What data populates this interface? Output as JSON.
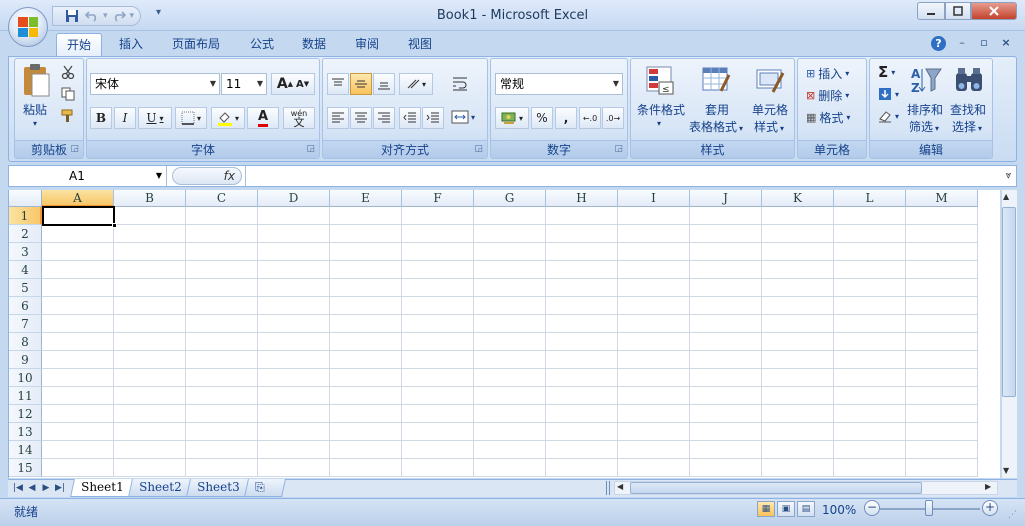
{
  "window": {
    "title": "Book1 - Microsoft Excel"
  },
  "qat": {
    "save_icon": "save-icon",
    "undo_icon": "undo-icon",
    "redo_icon": "redo-icon",
    "customize_icon": "customize-qat-icon"
  },
  "tabs": [
    {
      "label": "开始",
      "active": true
    },
    {
      "label": "插入"
    },
    {
      "label": "页面布局"
    },
    {
      "label": "公式"
    },
    {
      "label": "数据"
    },
    {
      "label": "审阅"
    },
    {
      "label": "视图"
    }
  ],
  "ribbon": {
    "clipboard": {
      "title": "剪贴板",
      "paste": "粘贴"
    },
    "font": {
      "title": "字体",
      "font_name": "宋体",
      "font_size": "11",
      "bold": "B",
      "italic": "I",
      "underline": "U",
      "grow": "A",
      "shrink": "A",
      "font_color": "A",
      "phonetic_top": "wén",
      "phonetic_bottom": "文"
    },
    "alignment": {
      "title": "对齐方式"
    },
    "number": {
      "title": "数字",
      "format": "常规",
      "percent": "%",
      "comma": ","
    },
    "styles": {
      "title": "样式",
      "cond_format": "条件格式",
      "table_format_1": "套用",
      "table_format_2": "表格格式",
      "cell_style_1": "单元格",
      "cell_style_2": "样式"
    },
    "cells": {
      "title": "单元格",
      "insert": "插入",
      "delete": "删除",
      "format": "格式"
    },
    "editing": {
      "title": "编辑",
      "sum": "Σ",
      "sort_1": "排序和",
      "sort_2": "筛选",
      "find_1": "查找和",
      "find_2": "选择"
    }
  },
  "formula_bar": {
    "name_box": "A1",
    "fx": "fx",
    "value": ""
  },
  "grid": {
    "columns": [
      "A",
      "B",
      "C",
      "D",
      "E",
      "F",
      "G",
      "H",
      "I",
      "J",
      "K",
      "L",
      "M"
    ],
    "rows": [
      "1",
      "2",
      "3",
      "4",
      "5",
      "6",
      "7",
      "8",
      "9",
      "10",
      "11",
      "12",
      "13",
      "14",
      "15"
    ],
    "selected_cell": "A1"
  },
  "sheets": [
    {
      "label": "Sheet1",
      "active": true
    },
    {
      "label": "Sheet2"
    },
    {
      "label": "Sheet3"
    }
  ],
  "status": {
    "text": "就绪",
    "zoom": "100%",
    "zoom_out": "−",
    "zoom_in": "+"
  },
  "colors": {
    "accent": "#15428b",
    "ribbon_bg": "#c4d8ef",
    "selection_header": "#f7c768"
  }
}
